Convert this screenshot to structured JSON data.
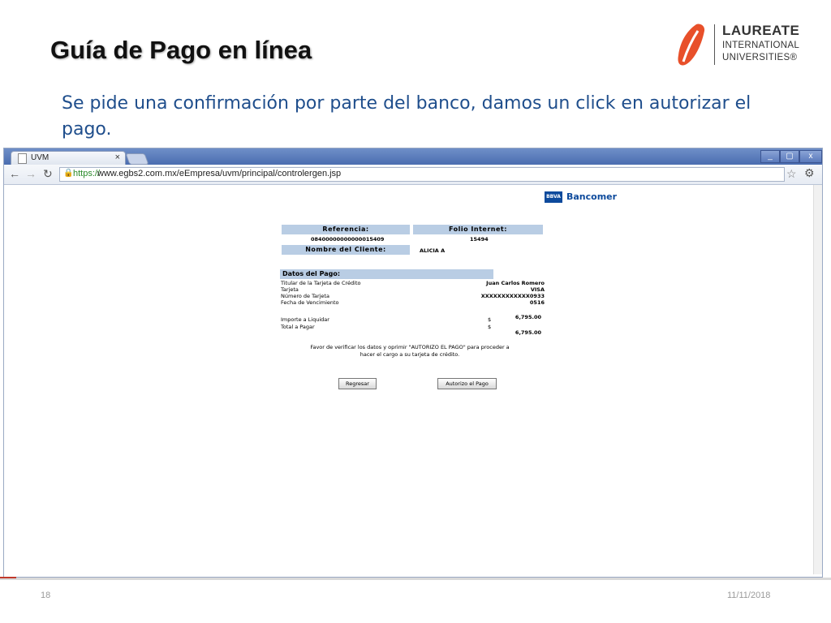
{
  "slide": {
    "title": "Guía de Pago en línea",
    "subtitle": "Se pide una confirmación por parte del banco, damos un click en autorizar el pago.",
    "page_number": "18",
    "date": "11/11/2018"
  },
  "logo": {
    "line1": "LAUREATE",
    "line2": "INTERNATIONAL",
    "line3": "UNIVERSITIES®",
    "color": "#e8502a"
  },
  "browser": {
    "tab_label": "UVM",
    "tab_close": "×",
    "url_scheme": "https://",
    "url_rest": "www.egbs2.com.mx/eEmpresa/uvm/principal/controlergen.jsp",
    "window_buttons": [
      "_",
      "▢",
      "x"
    ]
  },
  "page": {
    "bank_logo": "BBVA",
    "bank_name": "Bancomer",
    "referencia_label": "Referencia:",
    "referencia_value": "08400000000000015409",
    "folio_label": "Folio Internet:",
    "folio_value": "15494",
    "cliente_label": "Nombre del Cliente:",
    "cliente_value": "ALICIA A",
    "datos_header": "Datos del Pago:",
    "titular_label": "Titular de la Tarjeta de Crédito",
    "titular_value": "Juan Carlos Romero",
    "tarjeta_label": "Tarjeta",
    "tarjeta_value": "VISA",
    "numero_label": "Número de Tarjeta",
    "numero_value": "XXXXXXXXXXXX0933",
    "fecha_label": "Fecha de Vencimiento",
    "fecha_value": "0516",
    "importe_label": "Importe a Liquidar",
    "importe_symbol": "$",
    "importe_value": "6,795.00",
    "total_label": "Total a Pagar",
    "total_symbol": "$",
    "total_value": "6,795.00",
    "message_line1": "Favor de verificar los datos y oprimir \"AUTORIZO EL PAGO\" para proceder a",
    "message_line2": "hacer el cargo a su tarjeta de crédito.",
    "btn_regresar": "Regresar",
    "btn_autorizo": "Autorizo el Pago"
  }
}
